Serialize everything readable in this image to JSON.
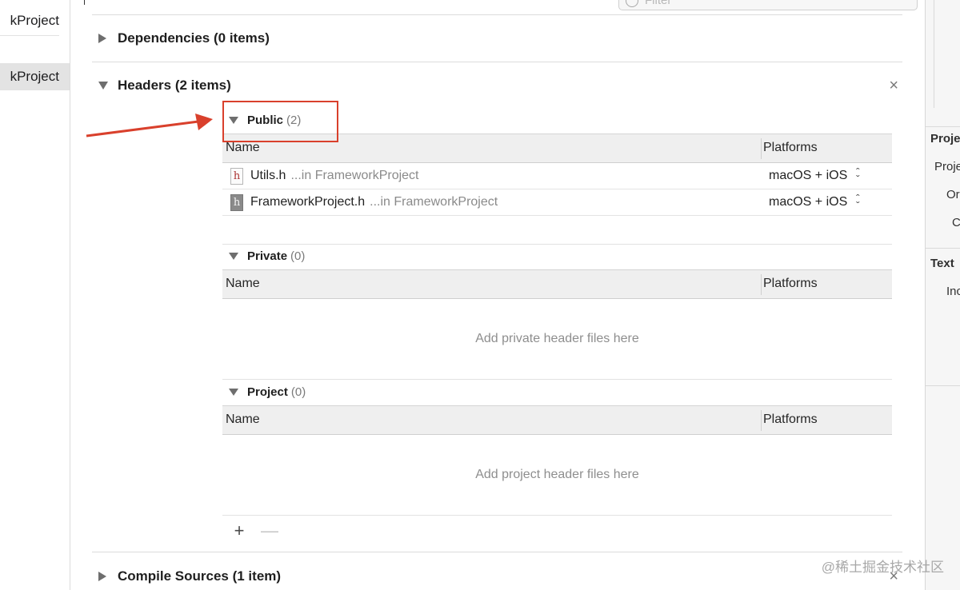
{
  "sidebar": {
    "items": [
      {
        "label": "kProject"
      },
      {
        "label": "kProject"
      }
    ]
  },
  "filter": {
    "placeholder": "Filter"
  },
  "phases": {
    "dependencies": {
      "title": "Dependencies (0 items)"
    },
    "headers": {
      "title": "Headers (2 items)"
    },
    "compile_sources": {
      "title": "Compile Sources (1 item)"
    }
  },
  "sections": {
    "public": {
      "title": "Public",
      "count": "(2)",
      "columns": {
        "name": "Name",
        "platforms": "Platforms"
      },
      "rows": [
        {
          "icon": "h",
          "name": "Utils.h",
          "location": "...in FrameworkProject",
          "platforms": "macOS + iOS"
        },
        {
          "icon": "h",
          "name": "FrameworkProject.h",
          "location": "...in FrameworkProject",
          "platforms": "macOS + iOS"
        }
      ]
    },
    "private": {
      "title": "Private",
      "count": "(0)",
      "columns": {
        "name": "Name",
        "platforms": "Platforms"
      },
      "placeholder": "Add private header files here"
    },
    "project": {
      "title": "Project",
      "count": "(0)",
      "columns": {
        "name": "Name",
        "platforms": "Platforms"
      },
      "placeholder": "Add project header files here"
    }
  },
  "controls": {
    "add": "+",
    "remove": "—",
    "close": "×"
  },
  "inspector": {
    "section1_title": "Proje",
    "fields": [
      "Proje",
      "Or",
      "C"
    ],
    "section2_title": "Text",
    "field2": "Inc"
  },
  "watermark": "@稀土掘金技术社区",
  "colors": {
    "annotation": "#d9402c",
    "arrow": "#d9402c"
  }
}
